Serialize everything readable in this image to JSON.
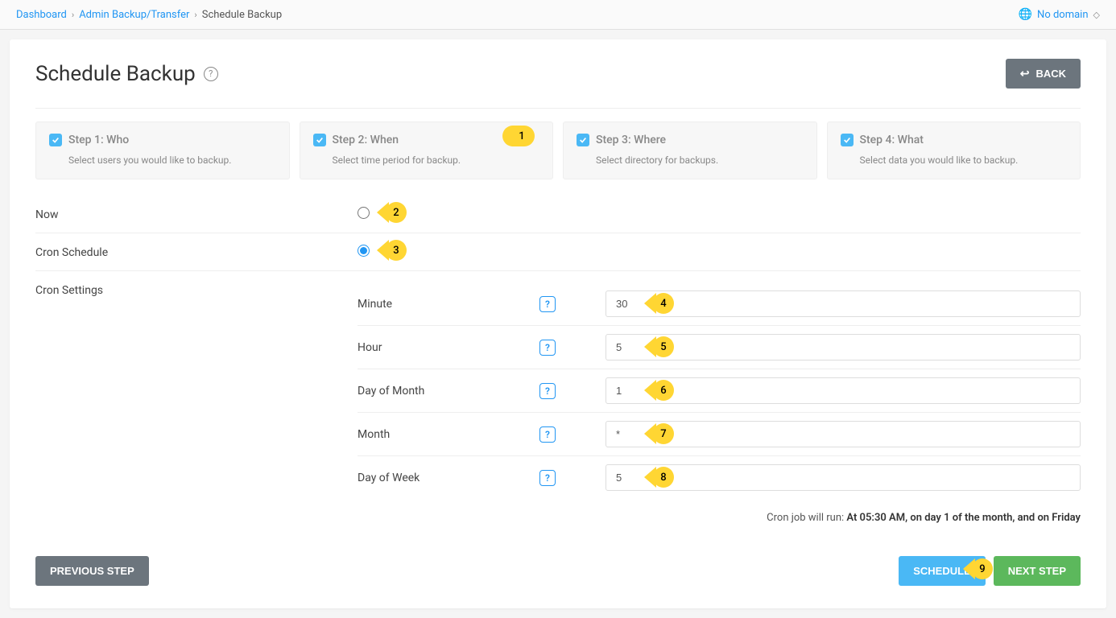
{
  "breadcrumb": {
    "items": [
      "Dashboard",
      "Admin Backup/Transfer",
      "Schedule Backup"
    ],
    "domain": "No domain"
  },
  "header": {
    "title": "Schedule Backup",
    "back": "BACK"
  },
  "steps": [
    {
      "title": "Step 1: Who",
      "desc": "Select users you would like to backup."
    },
    {
      "title": "Step 2: When",
      "desc": "Select time period for backup."
    },
    {
      "title": "Step 3: Where",
      "desc": "Select directory for backups."
    },
    {
      "title": "Step 4: What",
      "desc": "Select data you would like to backup."
    }
  ],
  "form": {
    "now": "Now",
    "cron_schedule": "Cron Schedule",
    "cron_settings": "Cron Settings",
    "fields": {
      "minute": {
        "label": "Minute",
        "value": "30"
      },
      "hour": {
        "label": "Hour",
        "value": "5"
      },
      "dom": {
        "label": "Day of Month",
        "value": "1"
      },
      "month": {
        "label": "Month",
        "value": "*"
      },
      "dow": {
        "label": "Day of Week",
        "value": "5"
      }
    },
    "summary_prefix": "Cron job will run:",
    "summary_value": "At 05:30 AM, on day 1 of the month, and on Friday"
  },
  "footer": {
    "previous": "PREVIOUS STEP",
    "schedule": "SCHEDULE",
    "next": "NEXT STEP"
  },
  "annotations": [
    "1",
    "2",
    "3",
    "4",
    "5",
    "6",
    "7",
    "8",
    "9"
  ]
}
